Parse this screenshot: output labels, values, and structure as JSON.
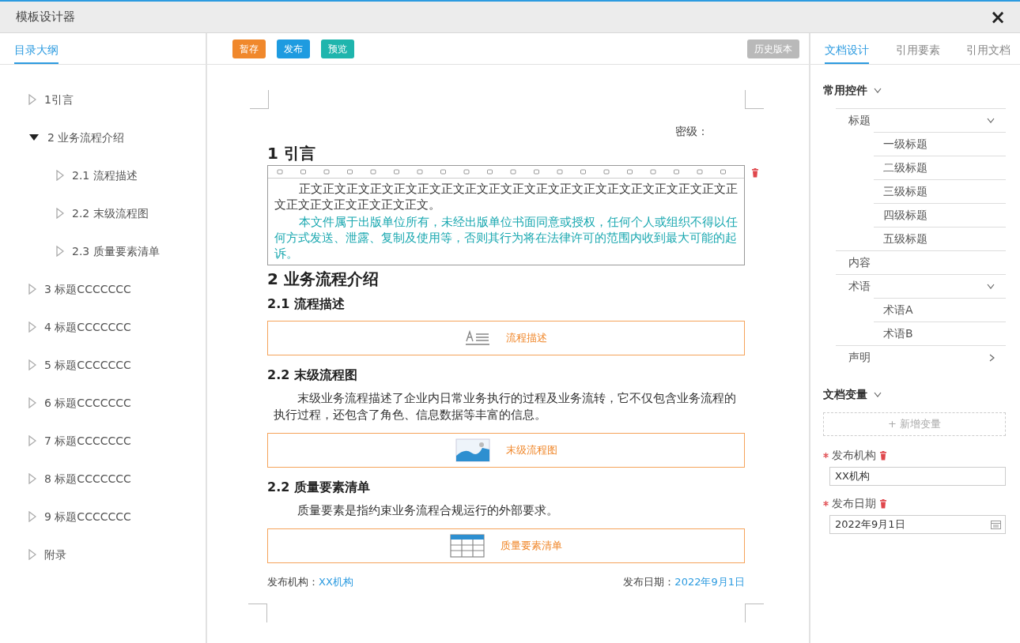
{
  "window": {
    "title": "模板设计器",
    "close": "×"
  },
  "outline": {
    "tab": {
      "label": "目录大纲",
      "selected": true
    },
    "items": [
      {
        "label": "1引言",
        "expanded": false
      },
      {
        "label": "2 业务流程介绍",
        "expanded": true,
        "children": [
          {
            "label": "2.1 流程描述",
            "expanded": false
          },
          {
            "label": "2.2 末级流程图",
            "expanded": false
          },
          {
            "label": "2.3 质量要素清单",
            "expanded": false
          }
        ]
      },
      {
        "label": "3 标题CCCCCCC",
        "expanded": false
      },
      {
        "label": "4 标题CCCCCCC",
        "expanded": false
      },
      {
        "label": "5 标题CCCCCCC",
        "expanded": false
      },
      {
        "label": "6 标题CCCCCCC",
        "expanded": false
      },
      {
        "label": "7 标题CCCCCCC",
        "expanded": false
      },
      {
        "label": "8 标题CCCCCCC",
        "expanded": false
      },
      {
        "label": "9 标题CCCCCCC",
        "expanded": false
      },
      {
        "label": "附录",
        "expanded": false
      }
    ]
  },
  "toolbar": {
    "buttons": [
      {
        "label": "暂存",
        "color": "#f0882c"
      },
      {
        "label": "发布",
        "color": "#1e9be0"
      },
      {
        "label": "预览",
        "color": "#1fb5ad"
      }
    ],
    "history_button": {
      "label": "历史版本",
      "disabled": true
    }
  },
  "document": {
    "secret_label": "密级：",
    "blocks": [
      {
        "kind": "h1",
        "text": "1 引言"
      },
      {
        "kind": "editor",
        "paragraphs": [
          {
            "kind": "body",
            "text": "正文正文正文正文正文正文正文正文正文正文正文正文正文正文正文正文正文正文正文正文正文正文正文正文正文。"
          },
          {
            "kind": "notice",
            "text": "本文件属于出版单位所有，未经出版单位书面同意或授权，任何个人或组织不得以任何方式发送、泄露、复制及使用等，否则其行为将在法律许可的范围内收到最大可能的起诉。"
          }
        ]
      },
      {
        "kind": "h1",
        "text": "2 业务流程介绍"
      },
      {
        "kind": "h2",
        "text": "2.1 流程描述"
      },
      {
        "kind": "text_widget",
        "text": "流程描述"
      },
      {
        "kind": "h2",
        "text": "2.2 末级流程图"
      },
      {
        "kind": "paragraph",
        "text": "末级业务流程描述了企业内日常业务执行的过程及业务流转，它不仅包含业务流程的执行过程，还包含了角色、信息数据等丰富的信息。"
      },
      {
        "kind": "image_widget",
        "text": "末级流程图"
      },
      {
        "kind": "h2",
        "text": "2.2 质量要素清单"
      },
      {
        "kind": "paragraph",
        "text": "质量要素是指约束业务流程合规运行的外部要求。"
      },
      {
        "kind": "table_widget",
        "text": "质量要素清单"
      }
    ],
    "footer": {
      "org_label": "发布机构：",
      "org": "XX机构",
      "date_label": "发布日期：",
      "date": "2022年9月1日"
    }
  },
  "design": {
    "tabs": [
      {
        "label": "文档设计",
        "selected": true
      },
      {
        "label": "引用要素",
        "selected": false
      },
      {
        "label": "引用文档",
        "selected": false
      }
    ],
    "controls": {
      "title": "常用控件",
      "expanded": true,
      "items": [
        {
          "label": "标题",
          "expanded": true,
          "children": [
            {
              "label": "一级标题"
            },
            {
              "label": "二级标题"
            },
            {
              "label": "三级标题"
            },
            {
              "label": "四级标题"
            },
            {
              "label": "五级标题"
            }
          ]
        },
        {
          "label": "内容"
        },
        {
          "label": "术语",
          "expanded": true,
          "children": [
            {
              "label": "术语A"
            },
            {
              "label": "术语B"
            }
          ]
        },
        {
          "label": "声明",
          "expanded": false
        }
      ]
    },
    "variables": {
      "title": "文档变量",
      "expanded": true,
      "add_button": "+ 新增变量",
      "items": [
        {
          "kind": "text",
          "label": "发布机构",
          "required": true,
          "value": "XX机构"
        },
        {
          "kind": "date",
          "label": "发布日期",
          "required": true,
          "value": "2022年9月1日"
        }
      ]
    }
  }
}
